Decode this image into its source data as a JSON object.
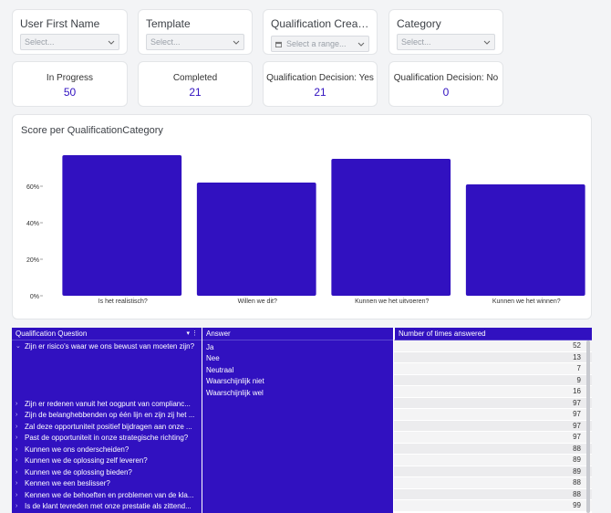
{
  "filters": [
    {
      "label": "User First Name",
      "placeholder": "Select..."
    },
    {
      "label": "Template",
      "placeholder": "Select..."
    },
    {
      "label": "Qualification Create D...",
      "placeholder": "Select a range..."
    },
    {
      "label": "Category",
      "placeholder": "Select..."
    }
  ],
  "kpis": [
    {
      "label": "In Progress",
      "value": "50"
    },
    {
      "label": "Completed",
      "value": "21"
    },
    {
      "label": "Qualification Decision: Yes",
      "value": "21"
    },
    {
      "label": "Qualification Decision: No",
      "value": "0"
    }
  ],
  "chart": {
    "title": "Score per QualificationCategory"
  },
  "chart_data": {
    "type": "bar",
    "title": "Score per QualificationCategory",
    "categories": [
      "Is het realistisch?",
      "Willen we dit?",
      "Kunnen we het uitvoeren?",
      "Kunnen we het winnen?"
    ],
    "values": [
      77,
      62,
      75,
      61
    ],
    "yticks": [
      "0%",
      "20%",
      "40%",
      "60%"
    ],
    "ylim": [
      0,
      80
    ],
    "color": "#3111c0",
    "grid": false
  },
  "table": {
    "headers": [
      "Qualification Question",
      "Answer",
      "Number of times answered"
    ],
    "expanded_question": "Zijn er risico's waar we ons bewust van moeten zijn?",
    "answers": [
      "Ja",
      "Nee",
      "Neutraal",
      "Waarschijnlijk niet",
      "Waarschijnlijk wel"
    ],
    "questions": [
      "Zijn er redenen vanuit het oogpunt van complianc...",
      "Zijn de belanghebbenden op één lijn en zijn zij het ...",
      "Zal deze opportuniteit positief bijdragen aan onze ...",
      "Past de opportuniteit in onze strategische richting?",
      "Kunnen we ons onderscheiden?",
      "Kunnen we de oplossing zelf leveren?",
      "Kunnen we de oplossing bieden?",
      "Kennen we een beslisser?",
      "Kennen we de behoeften en problemen van de kla...",
      "Is de klant tevreden met onze prestatie als zittend..."
    ],
    "counts": [
      "52",
      "13",
      "7",
      "9",
      "16",
      "97",
      "97",
      "97",
      "97",
      "88",
      "89",
      "89",
      "88",
      "88",
      "99"
    ]
  }
}
